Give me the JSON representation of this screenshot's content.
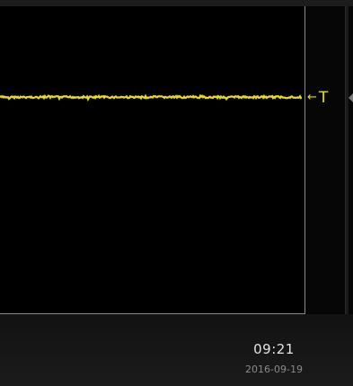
{
  "trigger": {
    "label": "T",
    "arrow": "←",
    "color": "#e6dc1e"
  },
  "trace": {
    "color": "#e6dc1e",
    "level_fraction_from_top": 0.295
  },
  "status": {
    "time": "09:21",
    "date": "2016-09-19"
  },
  "icons": {
    "trigger_arrow": "left-arrow-icon",
    "offscreen": "left-triangle-icon"
  }
}
